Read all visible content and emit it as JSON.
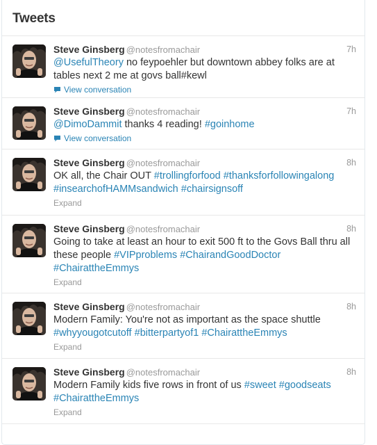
{
  "panel": {
    "title": "Tweets"
  },
  "tweets": [
    {
      "fullname": "Steve Ginsberg",
      "username": "@notesfromachair",
      "time": "7h",
      "segments": [
        {
          "type": "mention",
          "text": "@UsefulTheory"
        },
        {
          "type": "text",
          "text": " no feypoehler but downtown abbey folks are at tables next 2 me at govs ball#kewl"
        }
      ],
      "action": "View conversation",
      "action_type": "conversation"
    },
    {
      "fullname": "Steve Ginsberg",
      "username": "@notesfromachair",
      "time": "7h",
      "segments": [
        {
          "type": "mention",
          "text": "@DimoDammit"
        },
        {
          "type": "text",
          "text": " thanks 4 reading! "
        },
        {
          "type": "hashtag",
          "text": "#goinhome"
        }
      ],
      "action": "View conversation",
      "action_type": "conversation"
    },
    {
      "fullname": "Steve Ginsberg",
      "username": "@notesfromachair",
      "time": "8h",
      "segments": [
        {
          "type": "text",
          "text": "OK all, the Chair OUT "
        },
        {
          "type": "hashtag",
          "text": "#trollingforfood"
        },
        {
          "type": "text",
          "text": " "
        },
        {
          "type": "hashtag",
          "text": "#thanksforfollowingalong"
        },
        {
          "type": "text",
          "text": " "
        },
        {
          "type": "hashtag",
          "text": "#insearchofHAMMsandwich"
        },
        {
          "type": "text",
          "text": " "
        },
        {
          "type": "hashtag",
          "text": "#chairsignsoff"
        }
      ],
      "action": "Expand",
      "action_type": "expand"
    },
    {
      "fullname": "Steve Ginsberg",
      "username": "@notesfromachair",
      "time": "8h",
      "segments": [
        {
          "type": "text",
          "text": "Going to take at least an hour to exit 500 ft to the Govs Ball thru all these people "
        },
        {
          "type": "hashtag",
          "text": "#VIPproblems"
        },
        {
          "type": "text",
          "text": " "
        },
        {
          "type": "hashtag",
          "text": "#ChairandGoodDoctor"
        },
        {
          "type": "text",
          "text": " "
        },
        {
          "type": "hashtag",
          "text": "#ChairattheEmmys"
        }
      ],
      "action": "Expand",
      "action_type": "expand"
    },
    {
      "fullname": "Steve Ginsberg",
      "username": "@notesfromachair",
      "time": "8h",
      "segments": [
        {
          "type": "text",
          "text": "Modern Family: You're not as important as the space shuttle "
        },
        {
          "type": "hashtag",
          "text": "#whyyougotcutoff"
        },
        {
          "type": "text",
          "text": " "
        },
        {
          "type": "hashtag",
          "text": "#bitterpartyof1"
        },
        {
          "type": "text",
          "text": " "
        },
        {
          "type": "hashtag",
          "text": "#ChairattheEmmys"
        }
      ],
      "action": "Expand",
      "action_type": "expand"
    },
    {
      "fullname": "Steve Ginsberg",
      "username": "@notesfromachair",
      "time": "8h",
      "segments": [
        {
          "type": "text",
          "text": "Modern Family kids five rows in front of us "
        },
        {
          "type": "hashtag",
          "text": "#sweet"
        },
        {
          "type": "text",
          "text": " "
        },
        {
          "type": "hashtag",
          "text": "#goodseats"
        },
        {
          "type": "text",
          "text": " "
        },
        {
          "type": "hashtag",
          "text": "#ChairattheEmmys"
        }
      ],
      "action": "Expand",
      "action_type": "expand"
    }
  ],
  "colors": {
    "link": "#2a84b5",
    "muted": "#999999",
    "text": "#333333",
    "border": "#e8e8e8"
  },
  "icons": {
    "conversation": "speech-bubble-icon"
  }
}
